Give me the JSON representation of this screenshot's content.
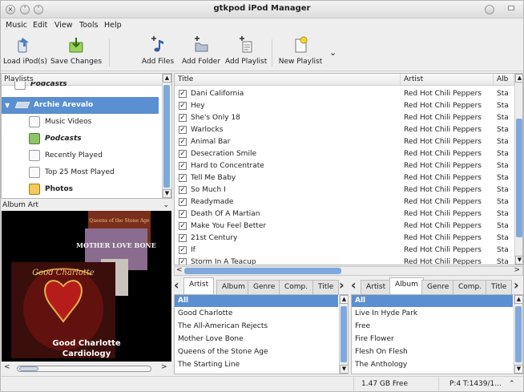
{
  "window": {
    "title": "gtkpod iPod Manager"
  },
  "menu": [
    "Music",
    "Edit",
    "View",
    "Tools",
    "Help"
  ],
  "toolbar": {
    "load": "Load iPod(s)",
    "save": "Save Changes",
    "add_files": "Add Files",
    "add_folder": "Add Folder",
    "add_playlist": "Add Playlist",
    "new_playlist": "New Playlist"
  },
  "playlists": {
    "header": "Playlists",
    "items": [
      {
        "label": "Podcasts",
        "icon": "ipod-icon"
      },
      {
        "label": "Archie Arevalo",
        "icon": "ipod-device-icon"
      },
      {
        "label": "Music Videos",
        "icon": "playlist-icon"
      },
      {
        "label": "Podcasts",
        "icon": "podcast-icon"
      },
      {
        "label": "Recently Played",
        "icon": "playlist-icon"
      },
      {
        "label": "Top 25 Most Played",
        "icon": "playlist-icon"
      },
      {
        "label": "Photos",
        "icon": "photos-icon"
      }
    ]
  },
  "album_art": {
    "label": "Album Art",
    "caption_line1": "Good Charlotte",
    "caption_line2": "Cardiology",
    "cover_back_text": "Queens of the Stone Age",
    "cover_mid_text": "MOTHER LOVE BONE",
    "cover_front_text": "Good Charlotte"
  },
  "tracks": {
    "columns": [
      "Title",
      "Artist",
      "Alb"
    ],
    "rows": [
      {
        "title": "Dani California",
        "artist": "Red Hot Chili Peppers",
        "album": "Sta"
      },
      {
        "title": "Hey",
        "artist": "Red Hot Chili Peppers",
        "album": "Sta"
      },
      {
        "title": "She's Only 18",
        "artist": "Red Hot Chili Peppers",
        "album": "Sta"
      },
      {
        "title": "Warlocks",
        "artist": "Red Hot Chili Peppers",
        "album": "Sta"
      },
      {
        "title": "Animal Bar",
        "artist": "Red Hot Chili Peppers",
        "album": "Sta"
      },
      {
        "title": "Desecration Smile",
        "artist": "Red Hot Chili Peppers",
        "album": "Sta"
      },
      {
        "title": "Hard to Concentrate",
        "artist": "Red Hot Chili Peppers",
        "album": "Sta"
      },
      {
        "title": "Tell Me Baby",
        "artist": "Red Hot Chili Peppers",
        "album": "Sta"
      },
      {
        "title": "So Much I",
        "artist": "Red Hot Chili Peppers",
        "album": "Sta"
      },
      {
        "title": "Readymade",
        "artist": "Red Hot Chili Peppers",
        "album": "Sta"
      },
      {
        "title": "Death Of A Martian",
        "artist": "Red Hot Chili Peppers",
        "album": "Sta"
      },
      {
        "title": "Make You Feel Better",
        "artist": "Red Hot Chili Peppers",
        "album": "Sta"
      },
      {
        "title": "21st Century",
        "artist": "Red Hot Chili Peppers",
        "album": "Sta"
      },
      {
        "title": "If",
        "artist": "Red Hot Chili Peppers",
        "album": "Sta"
      },
      {
        "title": "Storm In A Teacup",
        "artist": "Red Hot Chili Peppers",
        "album": "Sta"
      }
    ]
  },
  "sort_left": {
    "tabs": [
      "Artist",
      "Album",
      "Genre",
      "Comp.",
      "Title"
    ],
    "active": "Artist",
    "items": [
      "All",
      "Good Charlotte",
      "The All-American Rejects",
      "Mother Love Bone",
      "Queens of the Stone Age",
      "The Starting Line"
    ]
  },
  "sort_right": {
    "tabs": [
      "Artist",
      "Album",
      "Genre",
      "Comp.",
      "Title"
    ],
    "active": "Album",
    "items": [
      "All",
      "Live In Hyde Park",
      "Free",
      "Fire Flower",
      "Flesh On Flesh",
      "The Anthology"
    ]
  },
  "status": {
    "free": "1.47 GB Free",
    "tracks": "P:4 T:1439/1..."
  },
  "colors": {
    "selection": "#5a8fd1",
    "scroll_thumb": "#7fa9dc"
  }
}
